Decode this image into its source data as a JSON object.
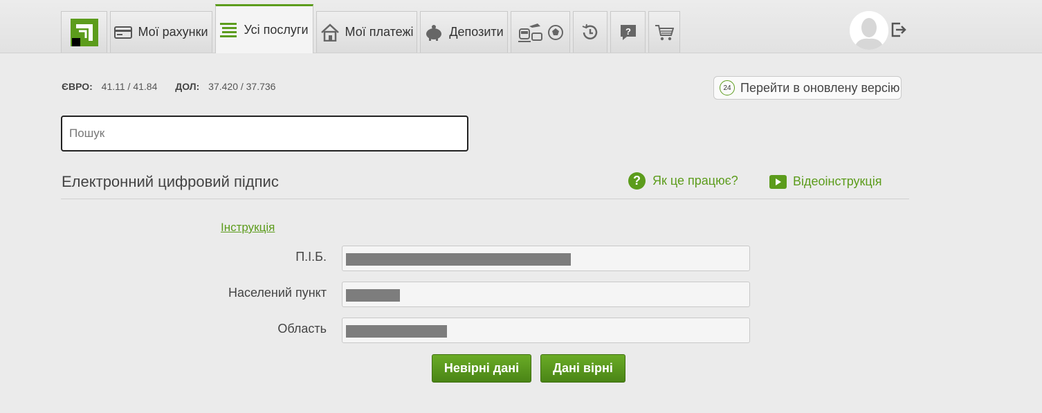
{
  "nav": {
    "tabs": [
      {
        "label": "",
        "icon": "privatbank-logo"
      },
      {
        "label": "Мої рахунки",
        "icon": "card-icon"
      },
      {
        "label": "Усі послуги",
        "icon": "list-icon",
        "active": true
      },
      {
        "label": "Мої платежі",
        "icon": "house-icon"
      },
      {
        "label": "Депозити",
        "icon": "piggy-bank-icon"
      },
      {
        "label": "",
        "icon": "travel-icon"
      },
      {
        "label": "",
        "icon": "history-icon"
      },
      {
        "label": "",
        "icon": "help-icon"
      },
      {
        "label": "",
        "icon": "cart-icon"
      }
    ]
  },
  "rates": {
    "eur_label": "ЄВРО:",
    "eur_value": "41.11 / 41.84",
    "usd_label": "ДОЛ:",
    "usd_value": "37.420 / 37.736"
  },
  "new_version": {
    "badge": "24",
    "label": "Перейти в оновлену версію"
  },
  "search": {
    "placeholder": "Пошук",
    "value": ""
  },
  "section": {
    "title": "Електронний цифровий підпис",
    "help_label": "Як це працює?",
    "video_label": "Відеоінструкція",
    "instruction_link": "Інструкція"
  },
  "form": {
    "fields": [
      {
        "label": "П.І.Б.",
        "value": "[redacted]"
      },
      {
        "label": "Населений пункт",
        "value": "[redacted]"
      },
      {
        "label": "Область",
        "value": "[redacted]"
      }
    ]
  },
  "buttons": {
    "wrong": "Невірні дані",
    "correct": "Дані вірні"
  },
  "colors": {
    "accent": "#5c9c1c",
    "button_top": "#6aab26",
    "button_bottom": "#4a8516",
    "background": "#ebebeb"
  }
}
